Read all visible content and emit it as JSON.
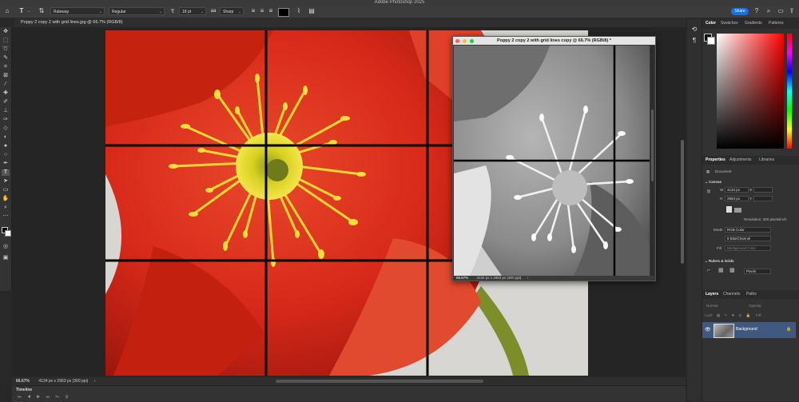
{
  "app": {
    "title": "Adobe Photoshop 2025"
  },
  "options_bar": {
    "font_family": "Raleway",
    "font_style": "Regular",
    "font_size": "18 pt",
    "antialias": "Sharp",
    "share_label": "Share"
  },
  "document": {
    "tab_title": "Poppy 2 copy 2 with grid lines.jpg @ 66.7% (RGB/8)",
    "zoom": "66.67%",
    "info": "4134 px x 2963 px (300 ppi)"
  },
  "float_window": {
    "title": "Poppy 2 copy 2 with grid lines copy @ 66.7% (RGB/8) *",
    "zoom": "66.67%",
    "info": "4134 px x 2963 px (300 ppi)"
  },
  "timeline": {
    "label": "Timeline"
  },
  "color_panel": {
    "tabs": [
      "Color",
      "Swatches",
      "Gradients",
      "Patterns"
    ]
  },
  "properties_panel": {
    "tabs": [
      "Properties",
      "Adjustments",
      "Libraries"
    ],
    "doc_label": "Document",
    "canvas_heading": "Canvas",
    "w_label": "W",
    "w_value": "4134 px",
    "h_label": "H",
    "h_value": "2963 px",
    "x_label": "X",
    "y_label": "Y",
    "resolution": "Resolution: 300 pixels/inch",
    "mode_label": "Mode",
    "mode_value": "RGB Color",
    "depth_value": "8 Bits/Channel",
    "fill_label": "Fill",
    "fill_value": "Background Color",
    "rulers_heading": "Rulers & Grids",
    "units_value": "Pixels"
  },
  "layers_panel": {
    "tabs": [
      "Layers",
      "Channels",
      "Paths"
    ],
    "blend_mode": "Normal",
    "opacity_label": "Opacity:",
    "lock_label": "Lock:",
    "fill_label": "Fill:",
    "layer_name": "Background"
  },
  "colors": {
    "accent": "#1473e6",
    "selected_layer": "#3f5a7e",
    "poppy_red": "#d8291a"
  }
}
